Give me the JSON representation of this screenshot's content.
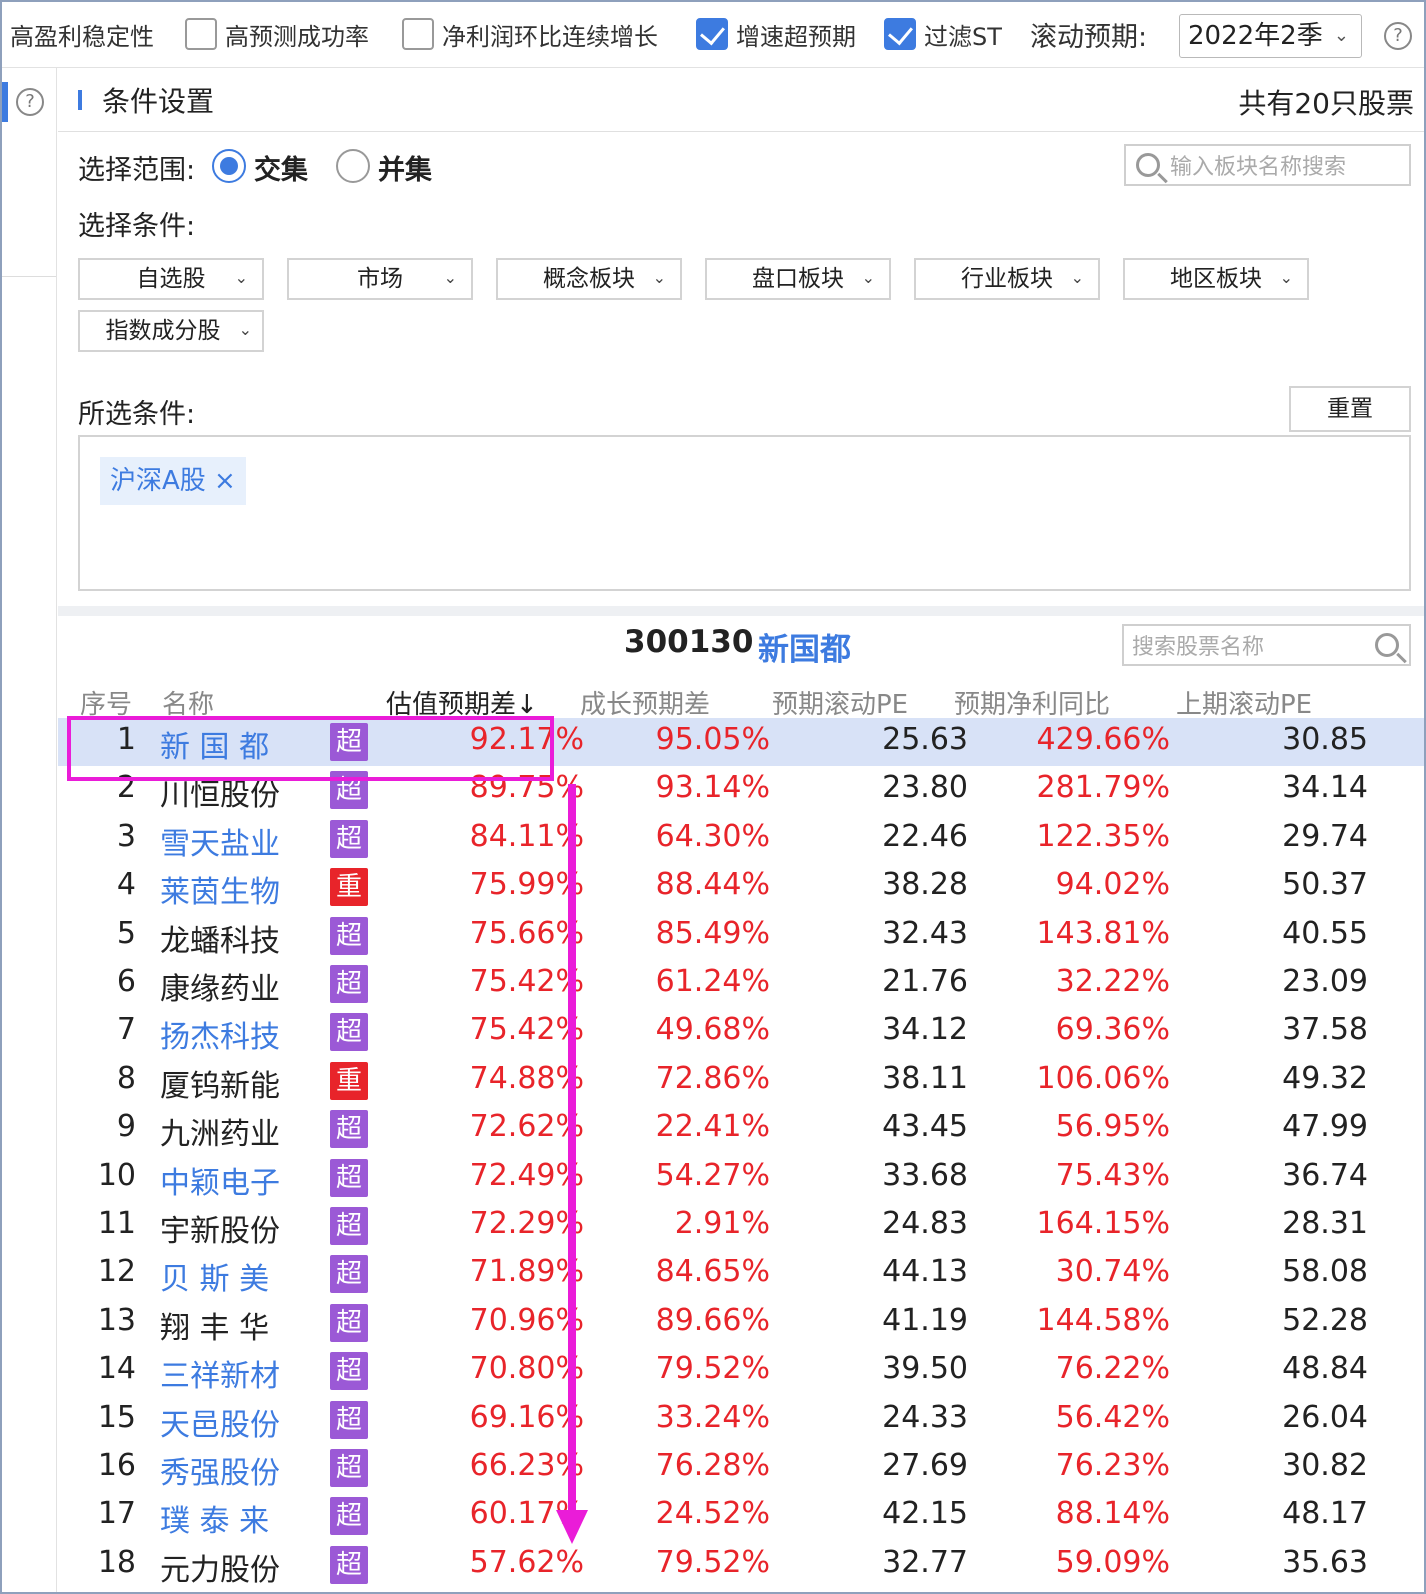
{
  "filters": [
    {
      "label": "高盈利稳定性",
      "checked": null
    },
    {
      "label": "高预测成功率",
      "checked": false
    },
    {
      "label": "净利润环比连续增长",
      "checked": false
    },
    {
      "label": "增速超预期",
      "checked": true
    },
    {
      "label": "过滤ST",
      "checked": true
    }
  ],
  "rolling": {
    "label": "滚动预期:",
    "value": "2022年2季"
  },
  "help_icon": "?",
  "panel": {
    "title": "条件设置",
    "total": "共有20只股票"
  },
  "scope": {
    "label": "选择范围:",
    "intersect": "交集",
    "union": "并集",
    "selected": "交集"
  },
  "block_search": {
    "placeholder": "输入板块名称搜索"
  },
  "conditions": {
    "label": "选择条件:",
    "dropdowns": [
      "自选股",
      "市场",
      "概念板块",
      "盘口板块",
      "行业板块",
      "地区板块",
      "指数成分股"
    ]
  },
  "selected": {
    "label": "所选条件:",
    "reset": "重置",
    "tags": [
      "沪深A股 ×"
    ]
  },
  "stock": {
    "code": "300130",
    "name": "新国都"
  },
  "stock_search": {
    "placeholder": "搜索股票名称"
  },
  "table": {
    "headers": [
      "序号",
      "名称",
      "估值预期差↓",
      "成长预期差",
      "预期滚动PE",
      "预期净利同比",
      "上期滚动PE"
    ],
    "rows": [
      {
        "no": "1",
        "name": "新 国 都",
        "badge": "超",
        "val": "92.17%",
        "growth": "95.05%",
        "pe": "25.63",
        "profit": "429.66%",
        "prev": "30.85",
        "blue": true,
        "sel": true
      },
      {
        "no": "2",
        "name": "川恒股份",
        "badge": "超",
        "val": "89.75%",
        "growth": "93.14%",
        "pe": "23.80",
        "profit": "281.79%",
        "prev": "34.14",
        "blue": false
      },
      {
        "no": "3",
        "name": "雪天盐业",
        "badge": "超",
        "val": "84.11%",
        "growth": "64.30%",
        "pe": "22.46",
        "profit": "122.35%",
        "prev": "29.74",
        "blue": true
      },
      {
        "no": "4",
        "name": "莱茵生物",
        "badge": "重",
        "val": "75.99%",
        "growth": "88.44%",
        "pe": "38.28",
        "profit": "94.02%",
        "prev": "50.37",
        "blue": true
      },
      {
        "no": "5",
        "name": "龙蟠科技",
        "badge": "超",
        "val": "75.66%",
        "growth": "85.49%",
        "pe": "32.43",
        "profit": "143.81%",
        "prev": "40.55",
        "blue": false
      },
      {
        "no": "6",
        "name": "康缘药业",
        "badge": "超",
        "val": "75.42%",
        "growth": "61.24%",
        "pe": "21.76",
        "profit": "32.22%",
        "prev": "23.09",
        "blue": false
      },
      {
        "no": "7",
        "name": "扬杰科技",
        "badge": "超",
        "val": "75.42%",
        "growth": "49.68%",
        "pe": "34.12",
        "profit": "69.36%",
        "prev": "37.58",
        "blue": true
      },
      {
        "no": "8",
        "name": "厦钨新能",
        "badge": "重",
        "val": "74.88%",
        "growth": "72.86%",
        "pe": "38.11",
        "profit": "106.06%",
        "prev": "49.32",
        "blue": false
      },
      {
        "no": "9",
        "name": "九洲药业",
        "badge": "超",
        "val": "72.62%",
        "growth": "22.41%",
        "pe": "43.45",
        "profit": "56.95%",
        "prev": "47.99",
        "blue": false
      },
      {
        "no": "10",
        "name": "中颖电子",
        "badge": "超",
        "val": "72.49%",
        "growth": "54.27%",
        "pe": "33.68",
        "profit": "75.43%",
        "prev": "36.74",
        "blue": true
      },
      {
        "no": "11",
        "name": "宇新股份",
        "badge": "超",
        "val": "72.29%",
        "growth": "2.91%",
        "pe": "24.83",
        "profit": "164.15%",
        "prev": "28.31",
        "blue": false
      },
      {
        "no": "12",
        "name": "贝 斯 美",
        "badge": "超",
        "val": "71.89%",
        "growth": "84.65%",
        "pe": "44.13",
        "profit": "30.74%",
        "prev": "58.08",
        "blue": true
      },
      {
        "no": "13",
        "name": "翔 丰 华",
        "badge": "超",
        "val": "70.96%",
        "growth": "89.66%",
        "pe": "41.19",
        "profit": "144.58%",
        "prev": "52.28",
        "blue": false
      },
      {
        "no": "14",
        "name": "三祥新材",
        "badge": "超",
        "val": "70.80%",
        "growth": "79.52%",
        "pe": "39.50",
        "profit": "76.22%",
        "prev": "48.84",
        "blue": true
      },
      {
        "no": "15",
        "name": "天邑股份",
        "badge": "超",
        "val": "69.16%",
        "growth": "33.24%",
        "pe": "24.33",
        "profit": "56.42%",
        "prev": "26.04",
        "blue": true
      },
      {
        "no": "16",
        "name": "秀强股份",
        "badge": "超",
        "val": "66.23%",
        "growth": "76.28%",
        "pe": "27.69",
        "profit": "76.23%",
        "prev": "30.82",
        "blue": true
      },
      {
        "no": "17",
        "name": "璞 泰 来",
        "badge": "超",
        "val": "60.17%",
        "growth": "24.52%",
        "pe": "42.15",
        "profit": "88.14%",
        "prev": "48.17",
        "blue": true
      },
      {
        "no": "18",
        "name": "元力股份",
        "badge": "超",
        "val": "57.62%",
        "growth": "79.52%",
        "pe": "32.77",
        "profit": "59.09%",
        "prev": "35.63",
        "blue": false
      }
    ]
  },
  "colors": {
    "accent": "#3d7be0",
    "up": "#e8242a",
    "badge_super": "#9b59d6",
    "badge_heavy": "#e8242a",
    "annotation": "#ea1cd8",
    "selected_row": "#d8e2f7"
  }
}
